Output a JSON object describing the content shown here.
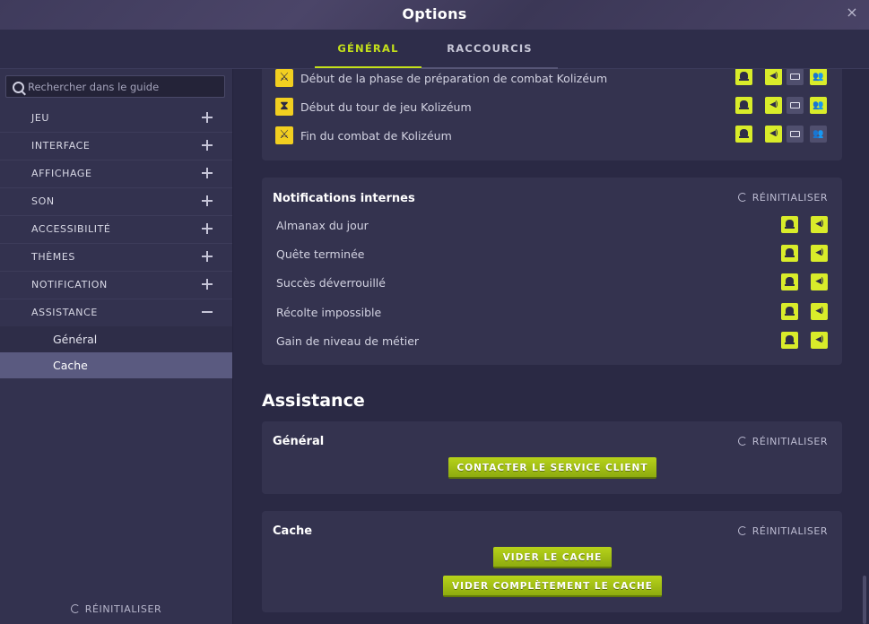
{
  "window": {
    "title": "Options",
    "close_label": "×"
  },
  "tabs": [
    {
      "label": "GÉNÉRAL",
      "active": true
    },
    {
      "label": "RACCOURCIS",
      "active": false
    }
  ],
  "sidebar": {
    "search_placeholder": "Rechercher dans le guide",
    "items": [
      {
        "label": "JEU",
        "sign": "plus"
      },
      {
        "label": "INTERFACE",
        "sign": "plus"
      },
      {
        "label": "AFFICHAGE",
        "sign": "plus"
      },
      {
        "label": "SON",
        "sign": "plus"
      },
      {
        "label": "ACCESSIBILITÉ",
        "sign": "plus"
      },
      {
        "label": "THÈMES",
        "sign": "plus"
      },
      {
        "label": "NOTIFICATION",
        "sign": "plus"
      },
      {
        "label": "ASSISTANCE",
        "sign": "minus"
      }
    ],
    "sub_items": [
      {
        "label": "Général",
        "selected": false
      },
      {
        "label": "Cache",
        "selected": true
      }
    ],
    "reset_label": "RÉINITIALISER"
  },
  "kolizeum_panel": {
    "events": [
      {
        "label": "Début de la phase de préparation de combat Kolizéum",
        "icon": "crossed-swords-icon"
      },
      {
        "label": "Début du tour de jeu Kolizéum",
        "icon": "hourglass-icon"
      },
      {
        "label": "Fin du combat de Kolizéum",
        "icon": "crossed-swords-icon"
      }
    ]
  },
  "internal_notifications": {
    "title": "Notifications internes",
    "reset_label": "RÉINITIALISER",
    "rows": [
      "Almanax du jour",
      "Quête terminée",
      "Succès déverrouillé",
      "Récolte impossible",
      "Gain de niveau de métier"
    ]
  },
  "assistance": {
    "section_title": "Assistance",
    "general": {
      "title": "Général",
      "reset_label": "RÉINITIALISER",
      "contact_button": "CONTACTER LE SERVICE CLIENT"
    },
    "cache": {
      "title": "Cache",
      "reset_label": "RÉINITIALISER",
      "clear_button": "VIDER LE CACHE",
      "clear_all_button": "VIDER COMPLÈTEMENT LE CACHE"
    }
  },
  "colors": {
    "accent": "#c4e01a",
    "event_icon": "#f2cf20",
    "button": "#a3c116",
    "panel": "#34334f",
    "background": "#2a2944"
  }
}
